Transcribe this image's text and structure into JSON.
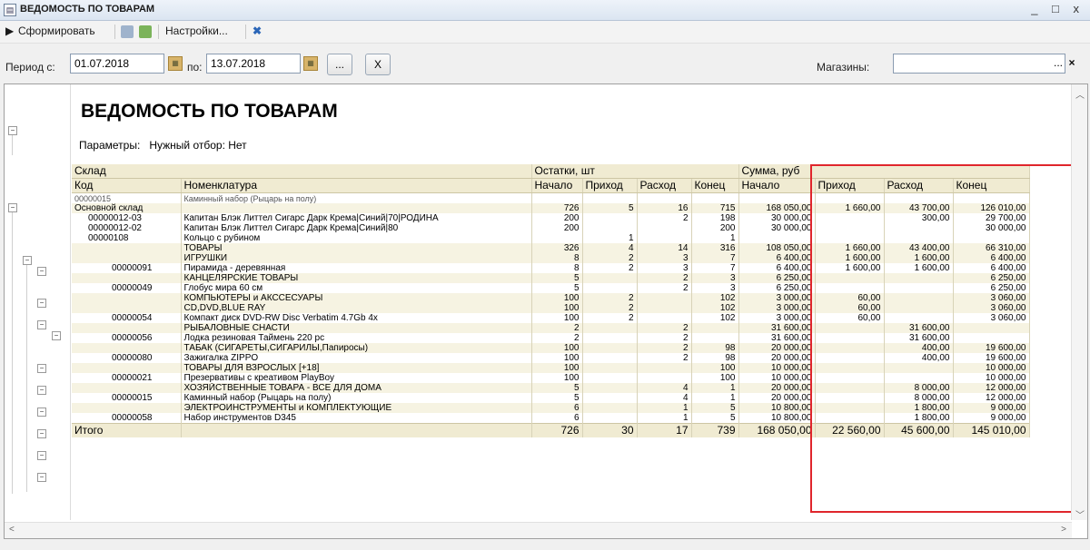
{
  "window": {
    "title": "ВЕДОМОСТЬ ПО ТОВАРАМ",
    "controls": "_ □ x"
  },
  "toolbar": {
    "generate_label": "Сформировать",
    "settings_label": "Настройки..."
  },
  "filters": {
    "period_from_label": "Период с:",
    "period_from_value": "01.07.2018",
    "period_to_label": "по:",
    "period_to_value": "13.07.2018",
    "ellipsis_label": "...",
    "clear_label": "X",
    "stores_label": "Магазины:",
    "stores_value": "",
    "stores_ellipsis": "...",
    "stores_clear": "×"
  },
  "report": {
    "title": "ВЕДОМОСТЬ ПО ТОВАРАМ",
    "params_label": "Параметры:",
    "params_value": "Нужный отбор: Нет",
    "group_headers": {
      "warehouse": "Склад",
      "balances": "Остатки, шт",
      "sums": "Сумма, руб"
    },
    "columns": [
      "Код",
      "Номенклатура",
      "Начало",
      "Приход",
      "Расход",
      "Конец",
      "Начало",
      "Приход",
      "Расход",
      "Конец"
    ],
    "cut_row": {
      "code": "00000015",
      "name": "Каминный набор (Рыцарь на полу)"
    },
    "rows": [
      {
        "code": "Основной склад",
        "name": "",
        "b_start": "726",
        "b_in": "5",
        "b_out": "16",
        "b_end": "715",
        "s_start": "168 050,00",
        "s_in": "1 660,00",
        "s_out": "43 700,00",
        "s_end": "126 010,00",
        "kind": "group"
      },
      {
        "code": "00000012-03",
        "name": "Капитан Блэк Литтел Сигарс Дарк Крема|Синий|70|РОДИНА",
        "b_start": "200",
        "b_in": "",
        "b_out": "2",
        "b_end": "198",
        "s_start": "30 000,00",
        "s_in": "",
        "s_out": "300,00",
        "s_end": "29 700,00",
        "kind": "item"
      },
      {
        "code": "00000012-02",
        "name": "Капитан Блэк Литтел Сигарс Дарк Крема|Синий|80",
        "b_start": "200",
        "b_in": "",
        "b_out": "",
        "b_end": "200",
        "s_start": "30 000,00",
        "s_in": "",
        "s_out": "",
        "s_end": "30 000,00",
        "kind": "item"
      },
      {
        "code": "00000108",
        "name": "Кольцо с рубином",
        "b_start": "",
        "b_in": "1",
        "b_out": "",
        "b_end": "1",
        "s_start": "",
        "s_in": "",
        "s_out": "",
        "s_end": "",
        "kind": "item"
      },
      {
        "code": "",
        "name": "ТОВАРЫ",
        "b_start": "326",
        "b_in": "4",
        "b_out": "14",
        "b_end": "316",
        "s_start": "108 050,00",
        "s_in": "1 660,00",
        "s_out": "43 400,00",
        "s_end": "66 310,00",
        "kind": "group"
      },
      {
        "code": "",
        "name": "ИГРУШКИ",
        "b_start": "8",
        "b_in": "2",
        "b_out": "3",
        "b_end": "7",
        "s_start": "6 400,00",
        "s_in": "1 600,00",
        "s_out": "1 600,00",
        "s_end": "6 400,00",
        "kind": "group"
      },
      {
        "code": "00000091",
        "name": "Пирамида - деревянная",
        "b_start": "8",
        "b_in": "2",
        "b_out": "3",
        "b_end": "7",
        "s_start": "6 400,00",
        "s_in": "1 600,00",
        "s_out": "1 600,00",
        "s_end": "6 400,00",
        "kind": "item"
      },
      {
        "code": "",
        "name": "КАНЦЕЛЯРСКИЕ ТОВАРЫ",
        "b_start": "5",
        "b_in": "",
        "b_out": "2",
        "b_end": "3",
        "s_start": "6 250,00",
        "s_in": "",
        "s_out": "",
        "s_end": "6 250,00",
        "kind": "group"
      },
      {
        "code": "00000049",
        "name": "Глобус мира 60 см",
        "b_start": "5",
        "b_in": "",
        "b_out": "2",
        "b_end": "3",
        "s_start": "6 250,00",
        "s_in": "",
        "s_out": "",
        "s_end": "6 250,00",
        "kind": "item"
      },
      {
        "code": "",
        "name": "КОМПЬЮТЕРЫ и АКССЕСУАРЫ",
        "b_start": "100",
        "b_in": "2",
        "b_out": "",
        "b_end": "102",
        "s_start": "3 000,00",
        "s_in": "60,00",
        "s_out": "",
        "s_end": "3 060,00",
        "kind": "group"
      },
      {
        "code": "",
        "name": "CD,DVD,BLUE RAY",
        "b_start": "100",
        "b_in": "2",
        "b_out": "",
        "b_end": "102",
        "s_start": "3 000,00",
        "s_in": "60,00",
        "s_out": "",
        "s_end": "3 060,00",
        "kind": "group"
      },
      {
        "code": "00000054",
        "name": "Компакт диск DVD-RW Disc Verbatim 4.7Gb 4x",
        "b_start": "100",
        "b_in": "2",
        "b_out": "",
        "b_end": "102",
        "s_start": "3 000,00",
        "s_in": "60,00",
        "s_out": "",
        "s_end": "3 060,00",
        "kind": "item"
      },
      {
        "code": "",
        "name": "РЫБАЛОВНЫЕ СНАСТИ",
        "b_start": "2",
        "b_in": "",
        "b_out": "2",
        "b_end": "",
        "s_start": "31 600,00",
        "s_in": "",
        "s_out": "31 600,00",
        "s_end": "",
        "kind": "group"
      },
      {
        "code": "00000056",
        "name": "Лодка резиновая Таймень 220 рс",
        "b_start": "2",
        "b_in": "",
        "b_out": "2",
        "b_end": "",
        "s_start": "31 600,00",
        "s_in": "",
        "s_out": "31 600,00",
        "s_end": "",
        "kind": "item"
      },
      {
        "code": "",
        "name": "ТАБАК (СИГАРЕТЫ,СИГАРИЛЫ,Папиросы)",
        "b_start": "100",
        "b_in": "",
        "b_out": "2",
        "b_end": "98",
        "s_start": "20 000,00",
        "s_in": "",
        "s_out": "400,00",
        "s_end": "19 600,00",
        "kind": "group"
      },
      {
        "code": "00000080",
        "name": "Зажигалка ZIPPO",
        "b_start": "100",
        "b_in": "",
        "b_out": "2",
        "b_end": "98",
        "s_start": "20 000,00",
        "s_in": "",
        "s_out": "400,00",
        "s_end": "19 600,00",
        "kind": "item"
      },
      {
        "code": "",
        "name": "ТОВАРЫ ДЛЯ ВЗРОСЛЫХ [+18]",
        "b_start": "100",
        "b_in": "",
        "b_out": "",
        "b_end": "100",
        "s_start": "10 000,00",
        "s_in": "",
        "s_out": "",
        "s_end": "10 000,00",
        "kind": "group"
      },
      {
        "code": "00000021",
        "name": "Презервативы с креативом PlayBoy",
        "b_start": "100",
        "b_in": "",
        "b_out": "",
        "b_end": "100",
        "s_start": "10 000,00",
        "s_in": "",
        "s_out": "",
        "s_end": "10 000,00",
        "kind": "item"
      },
      {
        "code": "",
        "name": "ХОЗЯЙСТВЕННЫЕ ТОВАРА - ВСЕ ДЛЯ ДОМА",
        "b_start": "5",
        "b_in": "",
        "b_out": "4",
        "b_end": "1",
        "s_start": "20 000,00",
        "s_in": "",
        "s_out": "8 000,00",
        "s_end": "12 000,00",
        "kind": "group"
      },
      {
        "code": "00000015",
        "name": "Каминный набор (Рыцарь на полу)",
        "b_start": "5",
        "b_in": "",
        "b_out": "4",
        "b_end": "1",
        "s_start": "20 000,00",
        "s_in": "",
        "s_out": "8 000,00",
        "s_end": "12 000,00",
        "kind": "item"
      },
      {
        "code": "",
        "name": "ЭЛЕКТРОИНСТРУМЕНТЫ и КОМПЛЕКТУЮЩИЕ",
        "b_start": "6",
        "b_in": "",
        "b_out": "1",
        "b_end": "5",
        "s_start": "10 800,00",
        "s_in": "",
        "s_out": "1 800,00",
        "s_end": "9 000,00",
        "kind": "group"
      },
      {
        "code": "00000058",
        "name": "Набор инструментов D345",
        "b_start": "6",
        "b_in": "",
        "b_out": "1",
        "b_end": "5",
        "s_start": "10 800,00",
        "s_in": "",
        "s_out": "1 800,00",
        "s_end": "9 000,00",
        "kind": "item"
      }
    ],
    "total": {
      "label": "Итого",
      "b_start": "726",
      "b_in": "30",
      "b_out": "17",
      "b_end": "739",
      "s_start": "168 050,00",
      "s_in": "22 560,00",
      "s_out": "45 600,00",
      "s_end": "145 010,00"
    }
  },
  "colors": {
    "highlight_border": "#e0262c",
    "header_bg": "#f0ebd2"
  }
}
